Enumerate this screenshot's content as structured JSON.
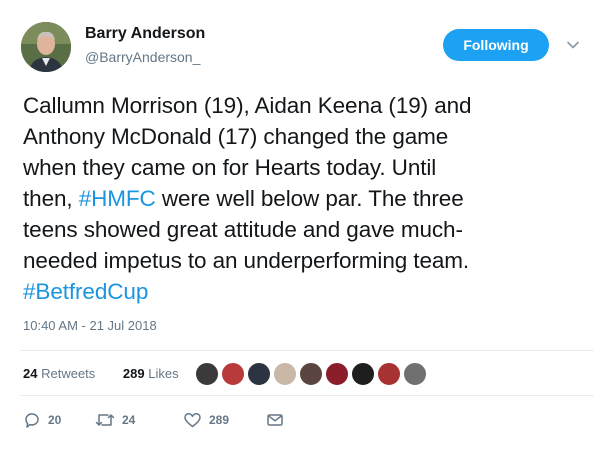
{
  "author": {
    "name": "Barry Anderson",
    "handle": "@BarryAnderson_"
  },
  "follow_button": {
    "label": "Following"
  },
  "tweet": {
    "lines": [
      [
        {
          "text": "Callumn Morrison (19), Aidan Keena (19) and",
          "link": false
        }
      ],
      [
        {
          "text": "Anthony McDonald (17) changed the game",
          "link": false
        }
      ],
      [
        {
          "text": "when they came on for Hearts today. Until",
          "link": false
        }
      ],
      [
        {
          "text": "then, ",
          "link": false
        },
        {
          "text": "#HMFC",
          "link": true
        },
        {
          "text": " were well below par. The three",
          "link": false
        }
      ],
      [
        {
          "text": "teens showed great attitude and gave much-",
          "link": false
        }
      ],
      [
        {
          "text": "needed impetus to an underperforming team.",
          "link": false
        }
      ],
      [
        {
          "text": "#BetfredCup",
          "link": true
        }
      ]
    ]
  },
  "timestamp": "10:40 AM - 21 Jul 2018",
  "stats": {
    "retweets_count": "24",
    "retweets_label": "Retweets",
    "likes_count": "289",
    "likes_label": "Likes"
  },
  "likers": [
    {
      "name": "liker-1",
      "color": "#3a3a3a"
    },
    {
      "name": "liker-2",
      "color": "#b83a3a"
    },
    {
      "name": "liker-3",
      "color": "#2b3440"
    },
    {
      "name": "liker-4",
      "color": "#c9b8a8"
    },
    {
      "name": "liker-5",
      "color": "#5b4540"
    },
    {
      "name": "liker-6",
      "color": "#8a1e2a"
    },
    {
      "name": "liker-7",
      "color": "#1e1e1e"
    },
    {
      "name": "liker-8",
      "color": "#a83232"
    },
    {
      "name": "liker-9",
      "color": "#707070"
    }
  ],
  "actions": {
    "replies": "20",
    "retweets": "24",
    "likes": "289"
  },
  "colors": {
    "accent": "#1da1f2",
    "link": "#1b95e0",
    "muted": "#657786",
    "text": "#14171a"
  },
  "icons": [
    "reply-icon",
    "retweet-icon",
    "like-icon",
    "message-icon",
    "chevron-down-icon"
  ]
}
